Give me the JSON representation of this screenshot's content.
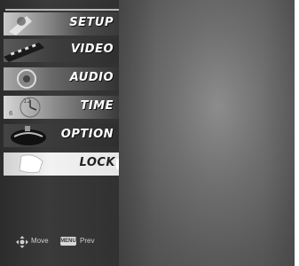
{
  "menu": {
    "items": [
      {
        "label": "SETUP",
        "icon": "setup-icon"
      },
      {
        "label": "VIDEO",
        "icon": "video-icon"
      },
      {
        "label": "AUDIO",
        "icon": "audio-icon"
      },
      {
        "label": "TIME",
        "icon": "time-icon"
      },
      {
        "label": "OPTION",
        "icon": "option-icon"
      },
      {
        "label": "LOCK",
        "icon": "lock-icon",
        "selected": true
      }
    ]
  },
  "footer": {
    "move_label": "Move",
    "prev_label": "Prev",
    "menu_key_label": "MENU",
    "move_icon": "four-way-arrow-icon"
  },
  "colors": {
    "panel_bg": "#333333",
    "label_text": "#ffffff",
    "selected_bg": "#e8e8e8",
    "video_bg": "#6f6f6f"
  }
}
